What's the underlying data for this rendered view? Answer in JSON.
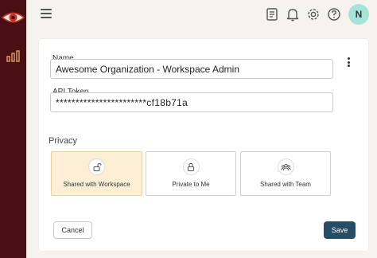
{
  "sidebar": {
    "logo_icon": "eye-logo-icon",
    "nav_icon": "bar-chart-icon",
    "bg_color": "#4a0f12"
  },
  "topbar": {
    "icons": [
      "menu-icon",
      "document-icon",
      "bell-icon",
      "gear-icon",
      "help-icon"
    ],
    "avatar_initial": "N",
    "avatar_color": "#a7e3d8"
  },
  "form": {
    "name_label": "Name",
    "name_value": "Awesome Organization - Workspace Admin",
    "token_label": "API Token",
    "token_value": "***********************cf18b71a",
    "privacy_title": "Privacy",
    "options": [
      {
        "label": "Shared with Workspace",
        "icon": "unlock-icon",
        "selected": true
      },
      {
        "label": "Private to Me",
        "icon": "lock-icon",
        "selected": false
      },
      {
        "label": "Shared with Team",
        "icon": "team-icon",
        "selected": false
      }
    ],
    "cancel_label": "Cancel",
    "save_label": "Save",
    "accent_color": "#264d63",
    "selected_color": "#fcefd6"
  }
}
